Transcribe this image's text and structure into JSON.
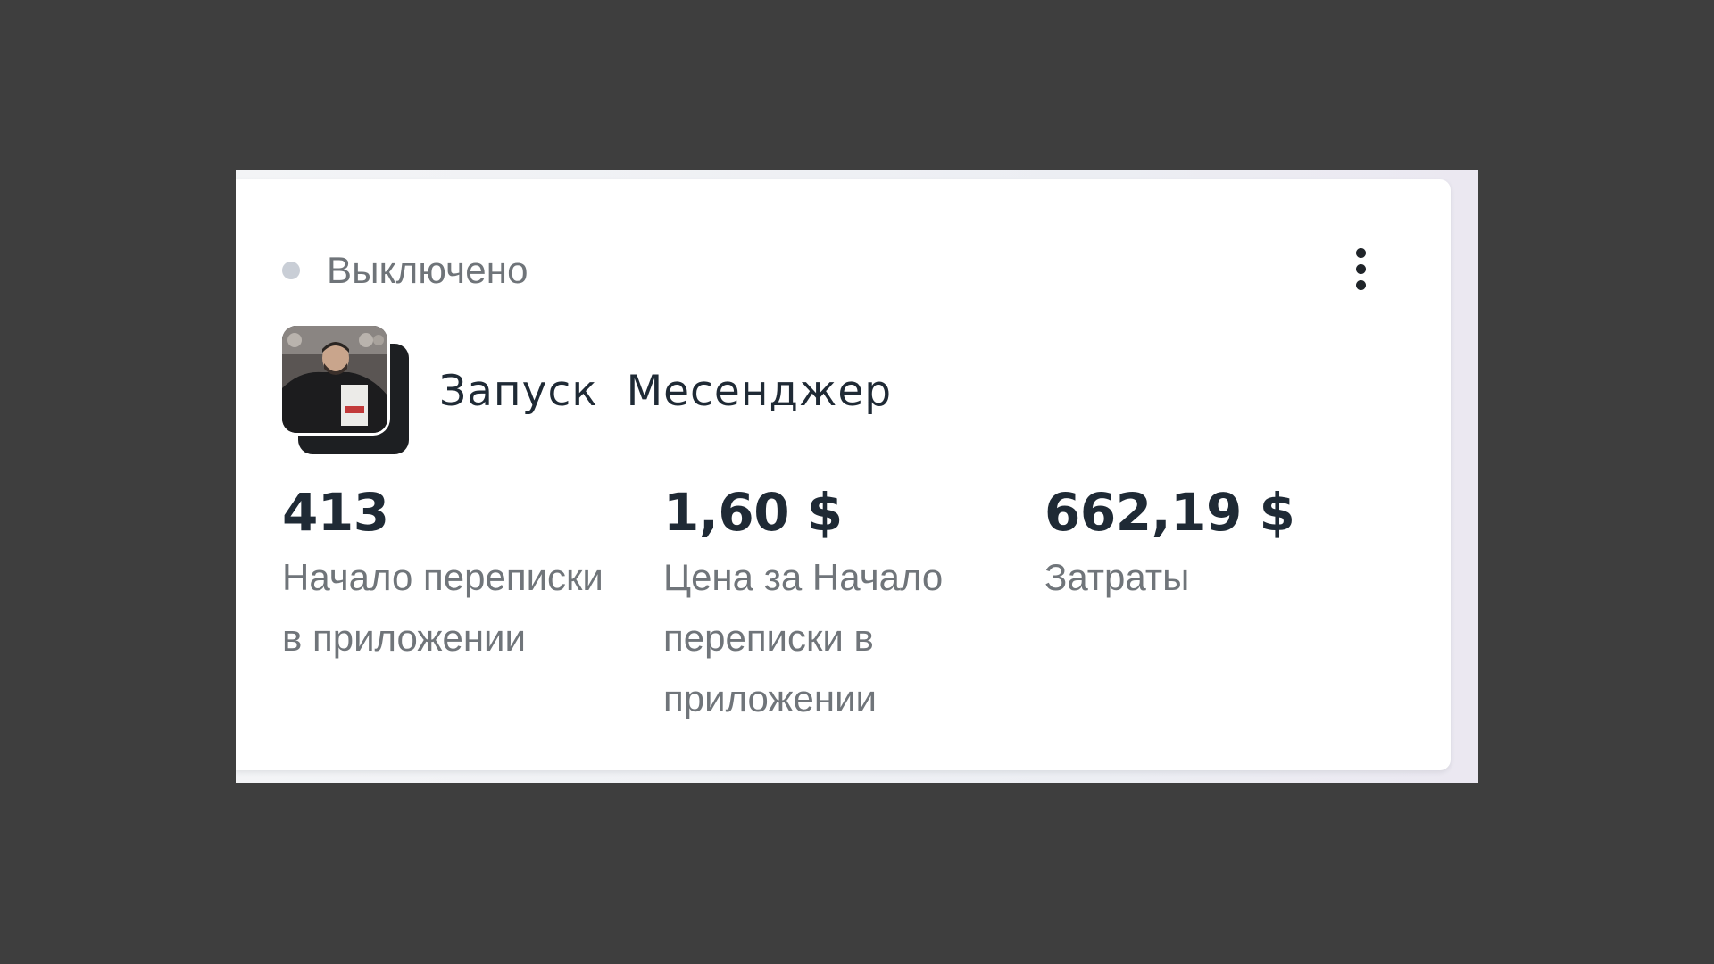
{
  "status": {
    "label": "Выключено",
    "dot_color": "#c9ced6"
  },
  "menu": {
    "icon": "more-vertical-icon"
  },
  "campaign": {
    "name": "Запуск  Месенджер",
    "thumbnail": "campaign-creative-thumbnail"
  },
  "metrics": [
    {
      "value": "413",
      "label": "Начало переписки в приложении"
    },
    {
      "value": "1,60 $",
      "label": "Цена за Начало переписки в приложении"
    },
    {
      "value": "662,19 $",
      "label": "Затраты"
    }
  ]
}
